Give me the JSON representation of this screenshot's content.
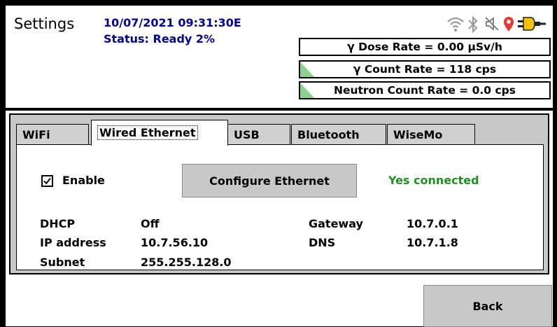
{
  "header": {
    "title": "Settings",
    "datetime": "10/07/2021 09:31:30E",
    "status": "Status: Ready 2%"
  },
  "status_icons": [
    "wifi-icon",
    "bluetooth-icon",
    "mute-icon",
    "location-pin-icon",
    "power-plug-icon"
  ],
  "readings": {
    "dose_rate": "γ Dose Rate = 0.00  µSv/h",
    "gamma_count": "γ Count Rate = 118 cps",
    "neutron_count": "Neutron Count Rate = 0.0 cps"
  },
  "tabs": [
    {
      "label": "WiFi"
    },
    {
      "label": "Wired Ethernet"
    },
    {
      "label": "USB"
    },
    {
      "label": "Bluetooth"
    },
    {
      "label": "WiseMo"
    }
  ],
  "active_tab": "Wired Ethernet",
  "ethernet": {
    "enable_label": "Enable",
    "enabled": true,
    "configure_label": "Configure Ethernet",
    "connection_status": "Yes connected",
    "dhcp_label": "DHCP",
    "dhcp_value": "Off",
    "ip_label": "IP address",
    "ip_value": "10.7.56.10",
    "subnet_label": "Subnet",
    "subnet_value": "255.255.128.0",
    "gateway_label": "Gateway",
    "gateway_value": "10.7.0.1",
    "dns_label": "DNS",
    "dns_value": "10.7.1.8"
  },
  "footer": {
    "back_label": "Back"
  },
  "colors": {
    "accent_text": "#00008b",
    "connected": "#1f8f1f",
    "indicator": "#8ed18e",
    "location_pin": "#e53935",
    "plug": "#f5c400"
  }
}
